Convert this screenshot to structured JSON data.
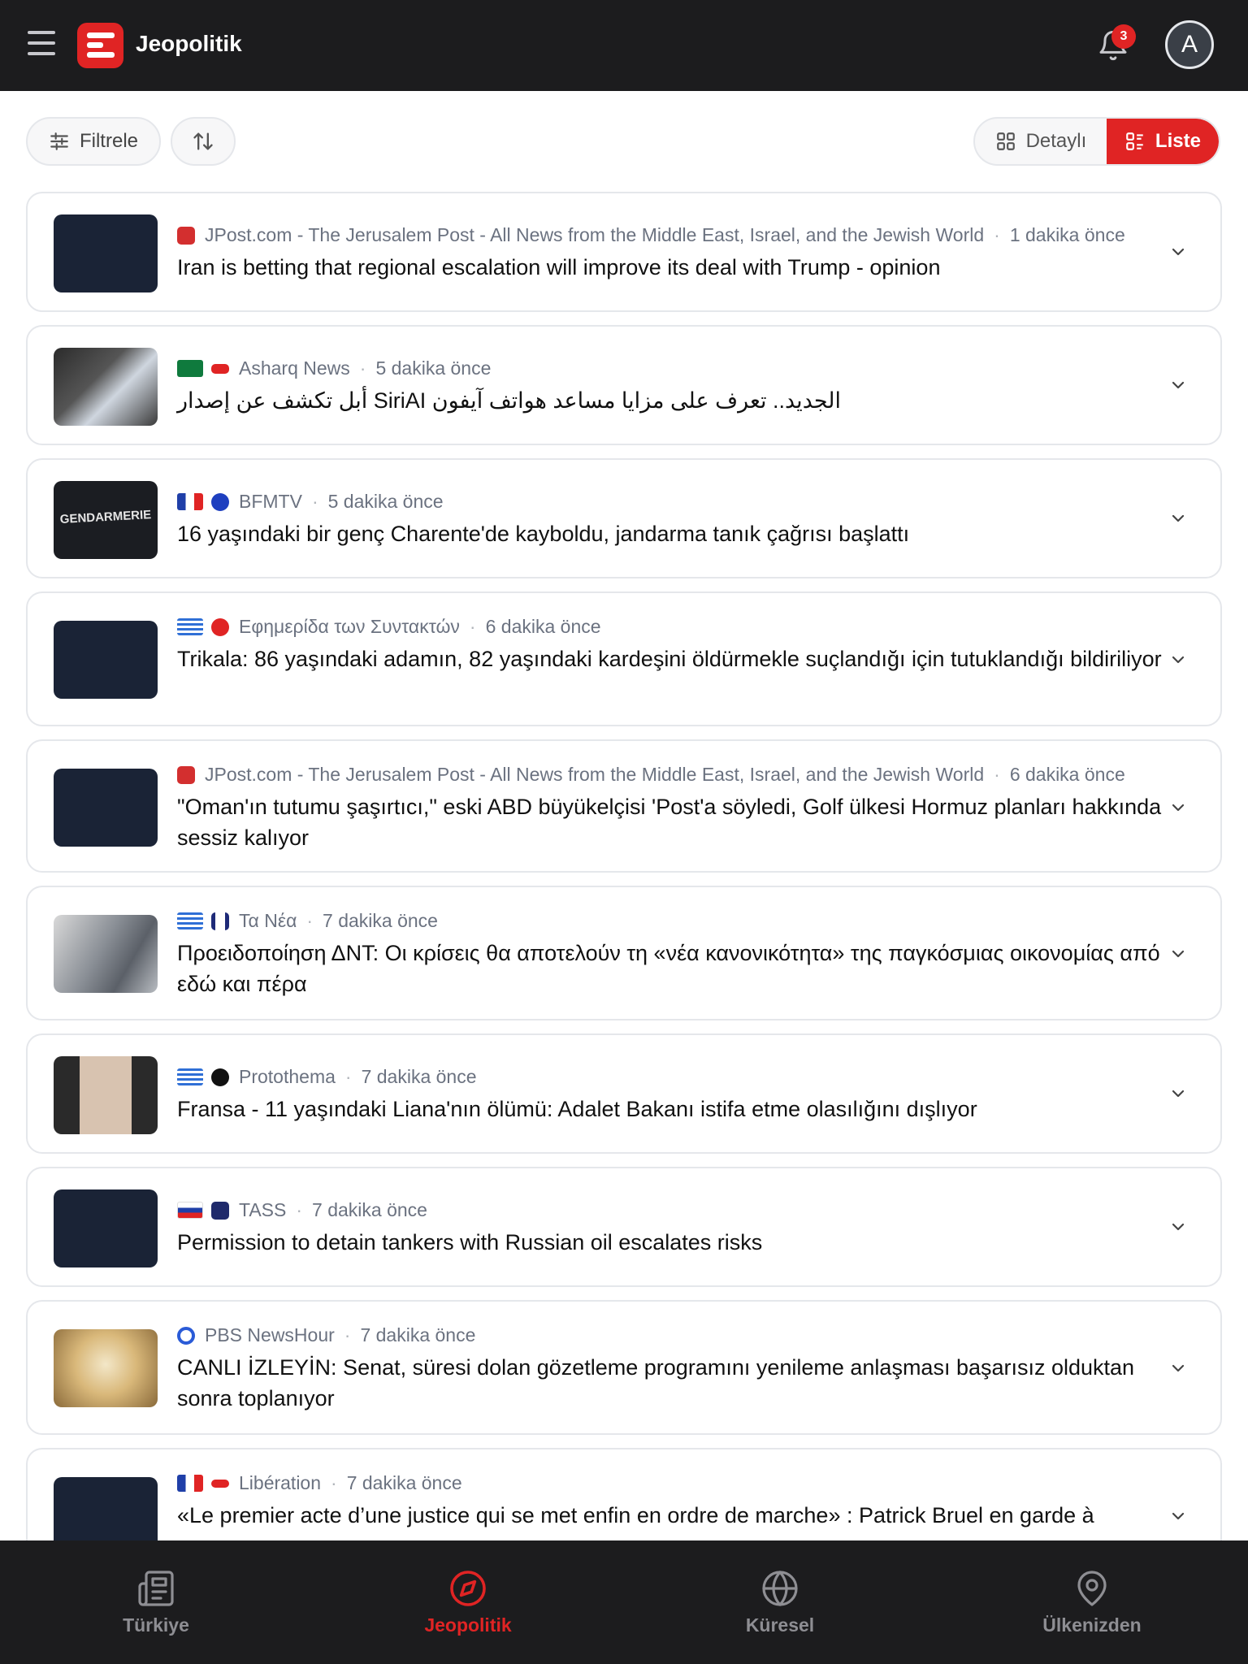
{
  "app": {
    "title": "Jeopolitik",
    "notification_count": "3",
    "avatar_letter": "A"
  },
  "toolbar": {
    "filter_label": "Filtrele",
    "view_detail_label": "Detaylı",
    "view_list_label": "Liste"
  },
  "news": [
    {
      "source": "JPost.com - The Jerusalem Post - All News from the Middle East, Israel, and the Jewish World",
      "time": "1 dakika önce",
      "title": "Iran is betting that regional escalation will improve its deal with Trump - opinion"
    },
    {
      "source": "Asharq News",
      "time": "5 dakika önce",
      "title": "الجديد.. تعرف على مزايا مساعد هواتف آيفون SiriAI أبل تكشف عن إصدار"
    },
    {
      "source": "BFMTV",
      "time": "5 dakika önce",
      "title": "16 yaşındaki bir genç Charente'de kayboldu, jandarma tanık çağrısı başlattı",
      "thumb_text": "GENDARMERIE"
    },
    {
      "source": "Εφημερίδα των Συντακτών",
      "time": "6 dakika önce",
      "title": "Trikala: 86 yaşındaki adamın, 82 yaşındaki kardeşini öldürmekle suçlandığı için tutuklandığı bildiriliyor"
    },
    {
      "source": "JPost.com - The Jerusalem Post - All News from the Middle East, Israel, and the Jewish World",
      "time": "6 dakika önce",
      "title": "\"Oman'ın tutumu şaşırtıcı,\" eski ABD büyükelçisi 'Post'a söyledi, Golf ülkesi Hormuz planları hakkında sessiz kalıyor"
    },
    {
      "source": "Τα Νέα",
      "time": "7 dakika önce",
      "title": "Προειδοποίηση ΔΝΤ: Οι κρίσεις θα αποτελούν τη «νέα κανονικότητα» της παγκόσμιας οικονομίας από εδώ και πέρα"
    },
    {
      "source": "Protothema",
      "time": "7 dakika önce",
      "title": "Fransa - 11 yaşındaki Liana'nın ölümü: Adalet Bakanı istifa etme olasılığını dışlıyor"
    },
    {
      "source": "TASS",
      "time": "7 dakika önce",
      "title": "Permission to detain tankers with Russian oil escalates risks"
    },
    {
      "source": "PBS NewsHour",
      "time": "7 dakika önce",
      "title": "CANLI İZLEYİN: Senat, süresi dolan gözetleme programını yenileme anlaşması başarısız olduktan sonra toplanıyor"
    },
    {
      "source": "Libération",
      "time": "7 dakika önce",
      "title": "«Le premier acte d’une justice qui se met enfin en ordre de marche» : Patrick Bruel en garde à"
    }
  ],
  "bottom_nav": [
    {
      "label": "Türkiye",
      "icon": "newspaper-icon"
    },
    {
      "label": "Jeopolitik",
      "icon": "compass-icon"
    },
    {
      "label": "Küresel",
      "icon": "globe-icon"
    },
    {
      "label": "Ülkenizden",
      "icon": "map-pin-icon"
    }
  ],
  "colors": {
    "accent": "#e02424",
    "topbar": "#1c1c1e",
    "muted": "#6b7280"
  }
}
